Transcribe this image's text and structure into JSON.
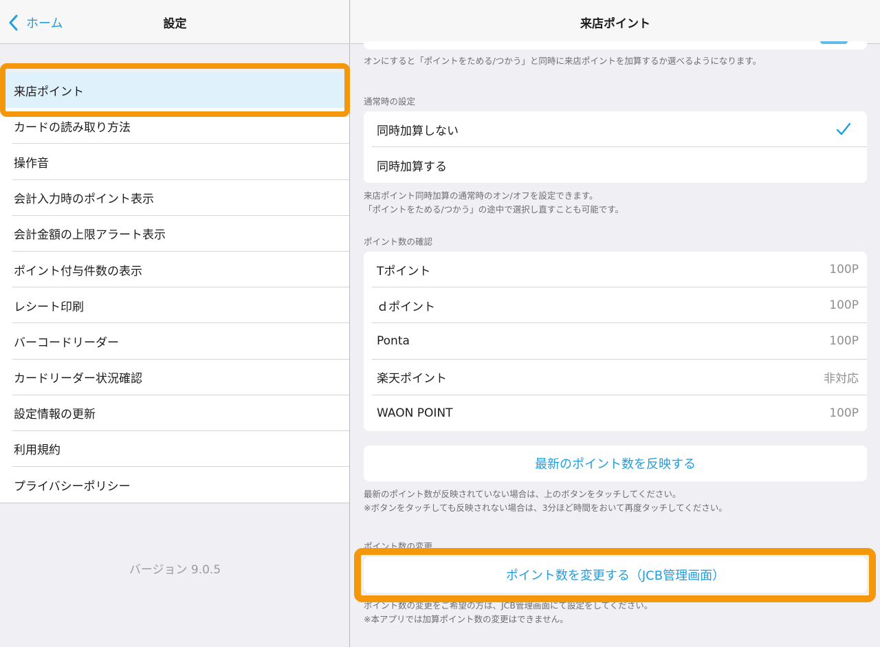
{
  "left": {
    "back_label": "ホーム",
    "title": "設定",
    "menu": [
      {
        "label": "来店ポイント",
        "selected": true
      },
      {
        "label": "カードの読み取り方法"
      },
      {
        "label": "操作音"
      },
      {
        "label": "会計入力時のポイント表示"
      },
      {
        "label": "会計金額の上限アラート表示"
      },
      {
        "label": "ポイント付与件数の表示"
      },
      {
        "label": "レシート印刷"
      },
      {
        "label": "バーコードリーダー"
      },
      {
        "label": "カードリーダー状況確認"
      },
      {
        "label": "設定情報の更新"
      },
      {
        "label": "利用規約"
      },
      {
        "label": "プライバシーポリシー"
      }
    ],
    "version": "バージョン 9.0.5"
  },
  "right": {
    "title": "来店ポイント",
    "top_note": "オンにすると「ポイントをためる/つかう」と同時に来店ポイントを加算するか選べるようになります。",
    "normal_section": {
      "header": "通常時の設定",
      "options": [
        {
          "label": "同時加算しない",
          "checked": true
        },
        {
          "label": "同時加算する",
          "checked": false
        }
      ],
      "note_line1": "来店ポイント同時加算の通常時のオン/オフを設定できます。",
      "note_line2": "「ポイントをためる/つかう」の途中で選択し直すことも可能です。"
    },
    "points_section": {
      "header": "ポイント数の確認",
      "rows": [
        {
          "label": "Tポイント",
          "value": "100P"
        },
        {
          "label": "ｄポイント",
          "value": "100P"
        },
        {
          "label": "Ponta",
          "value": "100P"
        },
        {
          "label": "楽天ポイント",
          "value": "非対応"
        },
        {
          "label": "WAON POINT",
          "value": "100P"
        }
      ]
    },
    "refresh_button": "最新のポイント数を反映する",
    "refresh_note_line1": "最新のポイント数が反映されていない場合は、上のボタンをタッチしてください。",
    "refresh_note_line2": "※ボタンをタッチしても反映されない場合は、3分ほど時間をおいて再度タッチしてください。",
    "change_section": {
      "header": "ポイント数の変更",
      "button": "ポイント数を変更する（JCB管理画面）",
      "note_line1": "ポイント数の変更をご希望の方は、JCB管理画面にて設定をしてください。",
      "note_line2": "※本アプリでは加算ポイント数の変更はできません。"
    }
  },
  "colors": {
    "accent": "#1f9ee0",
    "highlight": "#f5970a",
    "selected_bg": "#dff2fb"
  }
}
